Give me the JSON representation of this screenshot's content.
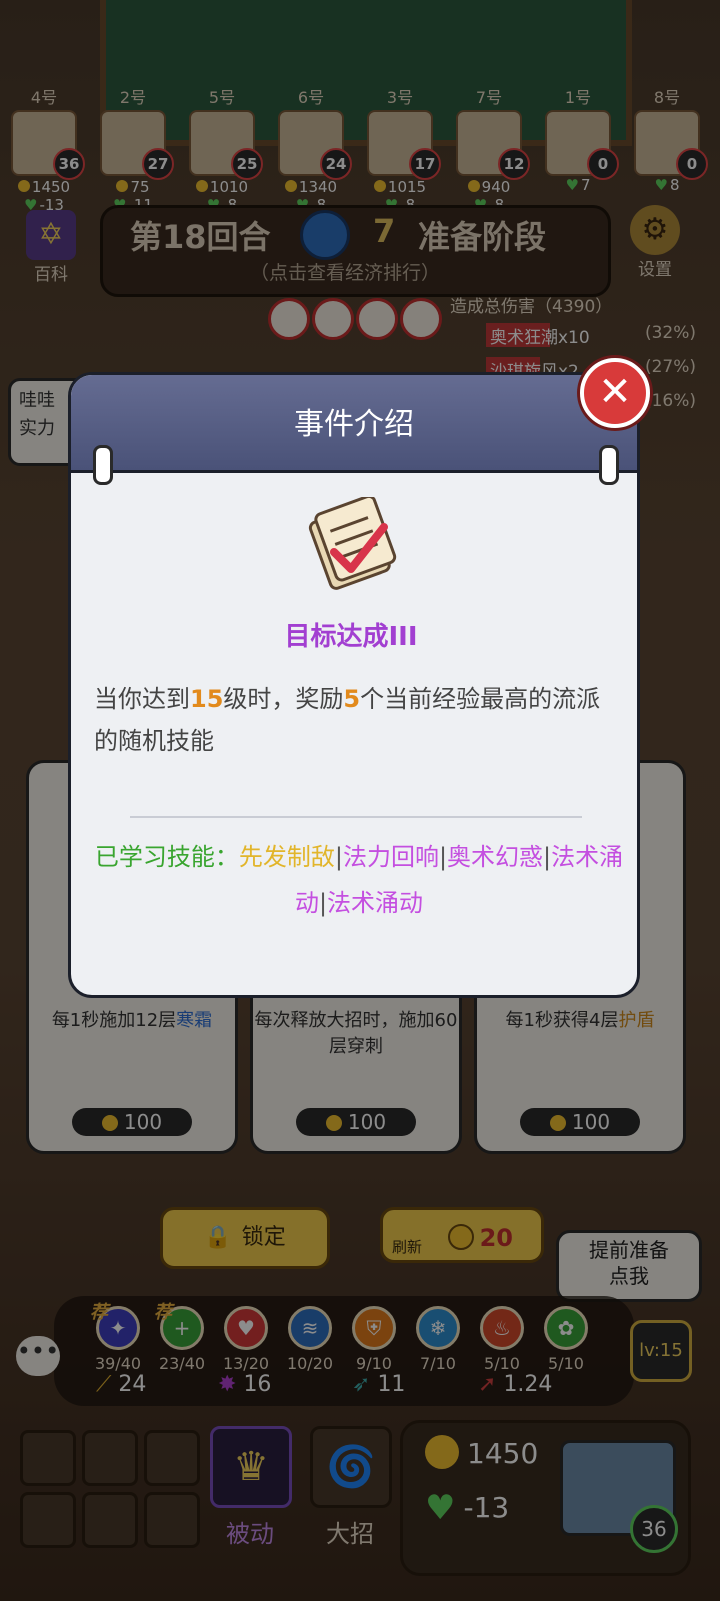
{
  "players": [
    {
      "num": "4号",
      "level": "36",
      "gold": "1450",
      "hp": "-13"
    },
    {
      "num": "2号",
      "level": "27",
      "gold": "75",
      "hp": "-11"
    },
    {
      "num": "5号",
      "level": "25",
      "gold": "1010",
      "hp": "-8"
    },
    {
      "num": "6号",
      "level": "24",
      "gold": "1340",
      "hp": "-8"
    },
    {
      "num": "3号",
      "level": "17",
      "gold": "1015",
      "hp": "-8"
    },
    {
      "num": "7号",
      "level": "12",
      "gold": "940",
      "hp": "-8"
    },
    {
      "num": "1号",
      "level": "0",
      "gold": "",
      "hp": "7"
    },
    {
      "num": "8号",
      "level": "0",
      "gold": "",
      "hp": "8"
    }
  ],
  "round": {
    "title": "第18回合",
    "timer": "7",
    "phase": "准备阶段",
    "subtitle": "（点击查看经济排行）"
  },
  "baike_label": "百科",
  "settings_label": "设置",
  "damage": {
    "header": "造成总伤害（4390）",
    "rows": [
      {
        "name": "奥术狂潮x10",
        "pct": "(32%)",
        "fill": 0.32
      },
      {
        "name": "沙琪旋风x2",
        "pct": "(27%)",
        "fill": 0.27
      },
      {
        "name": "",
        "pct": "(16%)",
        "fill": 0.16
      }
    ]
  },
  "left_bubble": "哇哇\n实力",
  "modal": {
    "title": "事件介绍",
    "close_icon": "close-icon",
    "event_name": "目标达成III",
    "desc_pre": "当你达到",
    "desc_level": "15",
    "desc_mid": "级时，奖励",
    "desc_count": "5",
    "desc_post": "个当前经验最高的流派的随机技能",
    "learned_label": "已学习技能：",
    "skill_1": "先发制敌",
    "skill_2": "法力回响",
    "skill_3": "奥术幻惑",
    "skill_4": "法术涌动",
    "skill_5": "法术涌动",
    "separator": "|"
  },
  "cards": [
    {
      "desc_pre": "每1秒施加12层",
      "keyword": "寒霜",
      "desc_post": "",
      "price": "100"
    },
    {
      "desc_pre": "每次释放大招时，施加60层穿刺",
      "keyword": "",
      "desc_post": "",
      "price": "100"
    },
    {
      "desc_pre": "每1秒获得4层",
      "keyword": "护盾",
      "desc_post": "",
      "price": "100"
    }
  ],
  "lock_label": "锁定",
  "refresh_label": "刷新",
  "refresh_cost": "20",
  "prepare_label": "提前准备\n点我",
  "recommend": "荐",
  "schools": [
    {
      "icon": "arcane-icon",
      "count": "39/40",
      "color": "#3f3fbf"
    },
    {
      "icon": "plus-icon",
      "count": "23/40",
      "color": "#3aa33a"
    },
    {
      "icon": "heart-icon",
      "count": "13/20",
      "color": "#d23a3a"
    },
    {
      "icon": "wind-icon",
      "count": "10/20",
      "color": "#2f6fc0"
    },
    {
      "icon": "shield-icon",
      "count": "9/10",
      "color": "#e07a1c"
    },
    {
      "icon": "snowflake-icon",
      "count": "7/10",
      "color": "#2f8fd0"
    },
    {
      "icon": "fire-icon",
      "count": "5/10",
      "color": "#d24a2a"
    },
    {
      "icon": "paw-icon",
      "count": "5/10",
      "color": "#3aa33a"
    }
  ],
  "level_badge": "lv:15",
  "stats": {
    "attack": "24",
    "crit": "16",
    "speed": "11",
    "multiplier": "1.24"
  },
  "chat_icon": "chat-icon",
  "bottom": {
    "passive_label": "被动",
    "ult_label": "大招",
    "my_gold": "1450",
    "my_hp": "-13",
    "my_level": "36"
  }
}
